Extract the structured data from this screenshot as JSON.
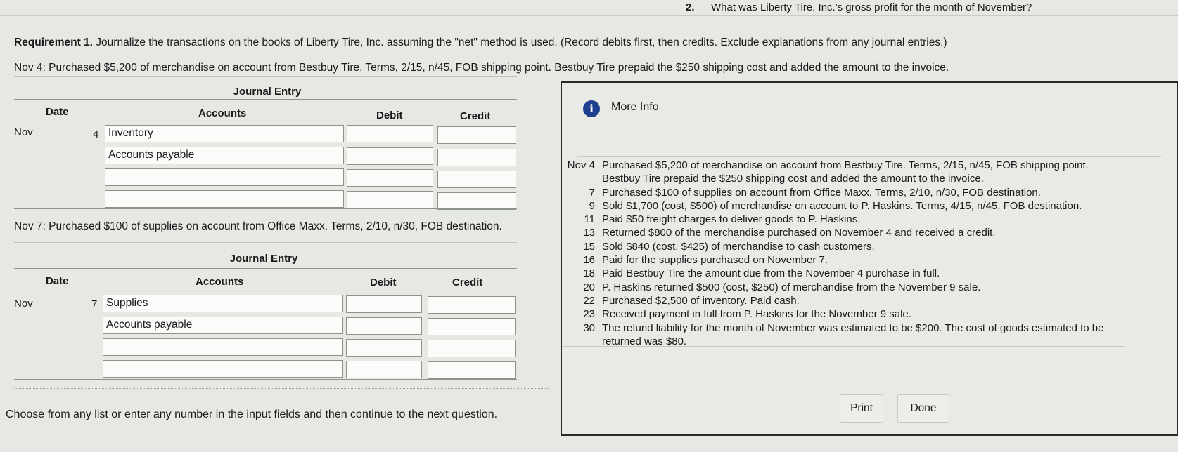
{
  "question": {
    "number": "2.",
    "text": "What was Liberty Tire, Inc.'s gross profit for the month of November?"
  },
  "requirement": {
    "label": "Requirement 1.",
    "text": "Journalize the transactions on the books of Liberty Tire, Inc. assuming the \"net\" method is used. (Record debits first, then credits. Exclude explanations from any journal entries.)"
  },
  "entry1": {
    "intro": "Nov 4: Purchased $5,200 of merchandise on account from Bestbuy Tire. Terms, 2/15, n/45, FOB shipping point. Bestbuy Tire prepaid the $250 shipping cost and added the amount to the invoice.",
    "title": "Journal Entry",
    "headers": {
      "date": "Date",
      "accounts": "Accounts",
      "debit": "Debit",
      "credit": "Credit"
    },
    "month": "Nov",
    "day": "4",
    "accounts": [
      "Inventory",
      "Accounts payable",
      "",
      ""
    ]
  },
  "entry2": {
    "intro": "Nov 7: Purchased $100 of supplies on account from Office Maxx. Terms, 2/10, n/30, FOB destination.",
    "title": "Journal Entry",
    "headers": {
      "date": "Date",
      "accounts": "Accounts",
      "debit": "Debit",
      "credit": "Credit"
    },
    "month": "Nov",
    "day": "7",
    "accounts": [
      "Supplies",
      "Accounts payable",
      "",
      ""
    ]
  },
  "footer": "Choose from any list or enter any number in the input fields and then continue to the next question.",
  "modal": {
    "title": "More Info",
    "month": "Nov",
    "transactions": [
      {
        "day": "4",
        "text": "Purchased $5,200 of merchandise on account from Bestbuy Tire. Terms, 2/15, n/45, FOB shipping point."
      },
      {
        "day": "",
        "text": "Bestbuy Tire prepaid the $250 shipping cost and added the amount to the invoice."
      },
      {
        "day": "7",
        "text": "Purchased $100 of supplies on account from Office Maxx. Terms, 2/10, n/30, FOB destination."
      },
      {
        "day": "9",
        "text": "Sold $1,700 (cost, $500) of merchandise on account to P. Haskins. Terms, 4/15, n/45, FOB destination."
      },
      {
        "day": "11",
        "text": "Paid $50 freight charges to deliver goods to P. Haskins."
      },
      {
        "day": "13",
        "text": "Returned $800 of the merchandise purchased on November 4 and received a credit."
      },
      {
        "day": "15",
        "text": "Sold $840 (cost, $425) of merchandise to cash customers."
      },
      {
        "day": "16",
        "text": "Paid for the supplies purchased on November 7."
      },
      {
        "day": "18",
        "text": "Paid Bestbuy Tire the amount due from the November 4 purchase in full."
      },
      {
        "day": "20",
        "text": "P. Haskins returned $500 (cost, $250) of merchandise from the November 9 sale."
      },
      {
        "day": "22",
        "text": "Purchased $2,500 of inventory. Paid cash."
      },
      {
        "day": "23",
        "text": "Received payment in full from P. Haskins for the November 9 sale."
      },
      {
        "day": "30",
        "text": "The refund liability for the month of November was estimated to be $200. The cost of goods estimated to be"
      },
      {
        "day": "",
        "text": "returned was $80."
      }
    ],
    "print_label": "Print",
    "done_label": "Done"
  }
}
